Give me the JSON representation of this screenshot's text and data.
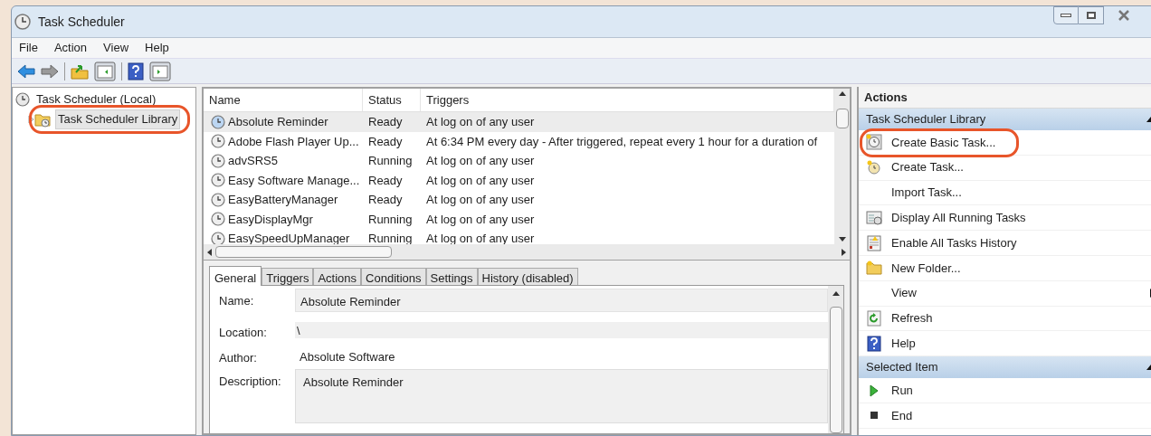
{
  "window": {
    "title": "Task Scheduler"
  },
  "menu": [
    "File",
    "Action",
    "View",
    "Help"
  ],
  "tree": [
    {
      "label": "Task Scheduler (Local)",
      "highlighted": false,
      "selected": false,
      "expanded": true,
      "children": [
        {
          "label": "Task Scheduler Library",
          "highlighted": true,
          "selected": true,
          "expanded": false
        }
      ]
    }
  ],
  "task_list": {
    "columns": [
      "Name",
      "Status",
      "Triggers"
    ],
    "rows": [
      {
        "name": "Absolute Reminder",
        "status": "Ready",
        "triggers": "At log on of any user",
        "selected": true
      },
      {
        "name": "Adobe Flash Player Up...",
        "status": "Ready",
        "triggers": "At 6:34 PM every day - After triggered, repeat every 1 hour for a duration of",
        "selected": false
      },
      {
        "name": "advSRS5",
        "status": "Running",
        "triggers": "At log on of any user",
        "selected": false
      },
      {
        "name": "Easy Software Manage...",
        "status": "Ready",
        "triggers": "At log on of any user",
        "selected": false
      },
      {
        "name": "EasyBatteryManager",
        "status": "Ready",
        "triggers": "At log on of any user",
        "selected": false
      },
      {
        "name": "EasyDisplayMgr",
        "status": "Running",
        "triggers": "At log on of any user",
        "selected": false
      },
      {
        "name": "EasySpeedUpManager",
        "status": "Running",
        "triggers": "At log on of any user",
        "selected": false
      }
    ]
  },
  "detail_tabs": [
    {
      "label": "General",
      "selected": true
    },
    {
      "label": "Triggers",
      "selected": false
    },
    {
      "label": "Actions",
      "selected": false
    },
    {
      "label": "Conditions",
      "selected": false
    },
    {
      "label": "Settings",
      "selected": false
    },
    {
      "label": "History (disabled)",
      "selected": false
    }
  ],
  "general": [
    {
      "label": "Name:",
      "value": "Absolute Reminder",
      "kind": "boxed"
    },
    {
      "label": "Location:",
      "value": "\\",
      "kind": "shaded"
    },
    {
      "label": "Author:",
      "value": "Absolute Software",
      "kind": "plain"
    },
    {
      "label": "Description:",
      "value": "Absolute Reminder",
      "kind": "area"
    }
  ],
  "actions_pane": {
    "title": "Actions",
    "groups": [
      {
        "title": "Task Scheduler Library",
        "items": [
          {
            "label": "Create Basic Task...",
            "kind": "clock",
            "highlighted": true,
            "submenu": false
          },
          {
            "label": "Create Task...",
            "kind": "newclock",
            "highlighted": false,
            "submenu": false
          },
          {
            "label": "Import Task...",
            "kind": "none",
            "highlighted": false,
            "submenu": false
          },
          {
            "label": "Display All Running Tasks",
            "kind": "window",
            "highlighted": false,
            "submenu": false
          },
          {
            "label": "Enable All Tasks History",
            "kind": "log",
            "highlighted": false,
            "submenu": false
          },
          {
            "label": "New Folder...",
            "kind": "folder",
            "highlighted": false,
            "submenu": false
          },
          {
            "label": "View",
            "kind": "none",
            "highlighted": false,
            "submenu": true
          },
          {
            "label": "Refresh",
            "kind": "refresh",
            "highlighted": false,
            "submenu": false
          },
          {
            "label": "Help",
            "kind": "help",
            "highlighted": false,
            "submenu": false
          }
        ]
      },
      {
        "title": "Selected Item",
        "items": [
          {
            "label": "Run",
            "kind": "run",
            "highlighted": false,
            "submenu": false
          },
          {
            "label": "End",
            "kind": "end",
            "highlighted": false,
            "submenu": false
          }
        ]
      }
    ]
  }
}
